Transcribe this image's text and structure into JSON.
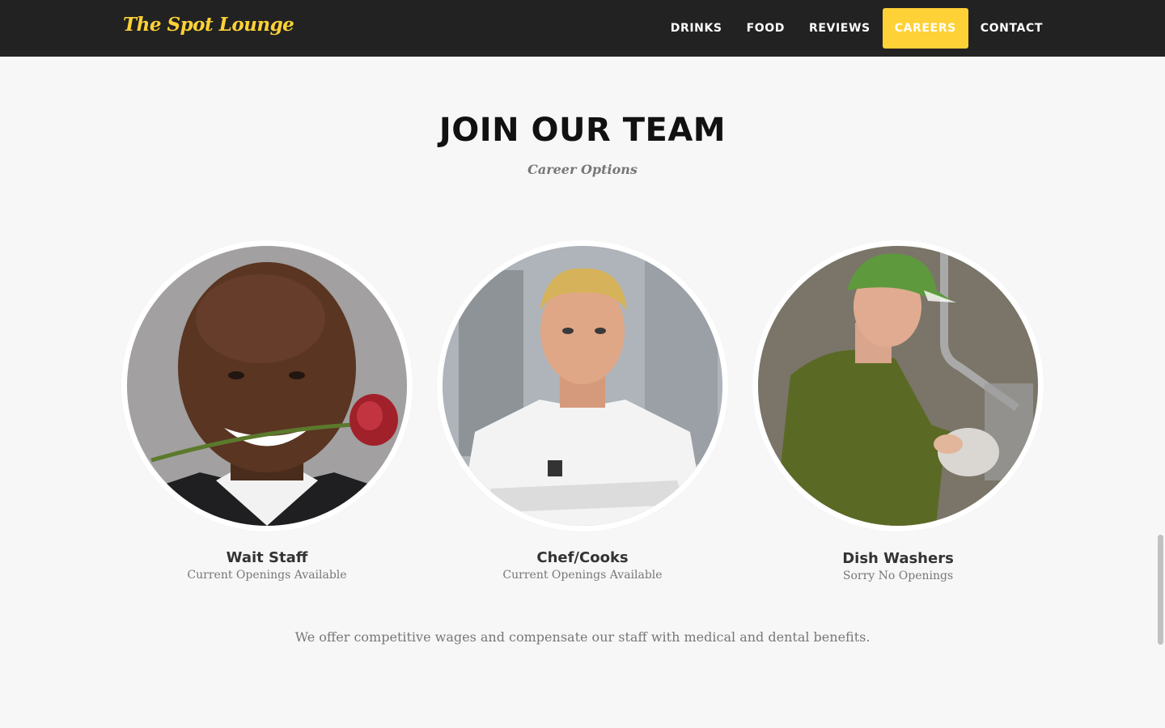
{
  "navbar": {
    "brand": "The Spot Lounge",
    "items": [
      {
        "label": "DRINKS",
        "active": false
      },
      {
        "label": "FOOD",
        "active": false
      },
      {
        "label": "REVIEWS",
        "active": false
      },
      {
        "label": "CAREERS",
        "active": true
      },
      {
        "label": "CONTACT",
        "active": false
      }
    ]
  },
  "section": {
    "heading": "JOIN OUR TEAM",
    "subheading": "Career Options"
  },
  "team": [
    {
      "name": "Wait Staff",
      "status": "Current Openings Available"
    },
    {
      "name": "Chef/Cooks",
      "status": "Current Openings Available"
    },
    {
      "name": "Dish Washers",
      "status": "Sorry No Openings"
    }
  ],
  "benefits_text": "We offer competitive wages and compensate our staff with medical and dental benefits.",
  "colors": {
    "navbar_bg": "#222222",
    "accent": "#fed136",
    "page_bg": "#f7f7f7"
  }
}
